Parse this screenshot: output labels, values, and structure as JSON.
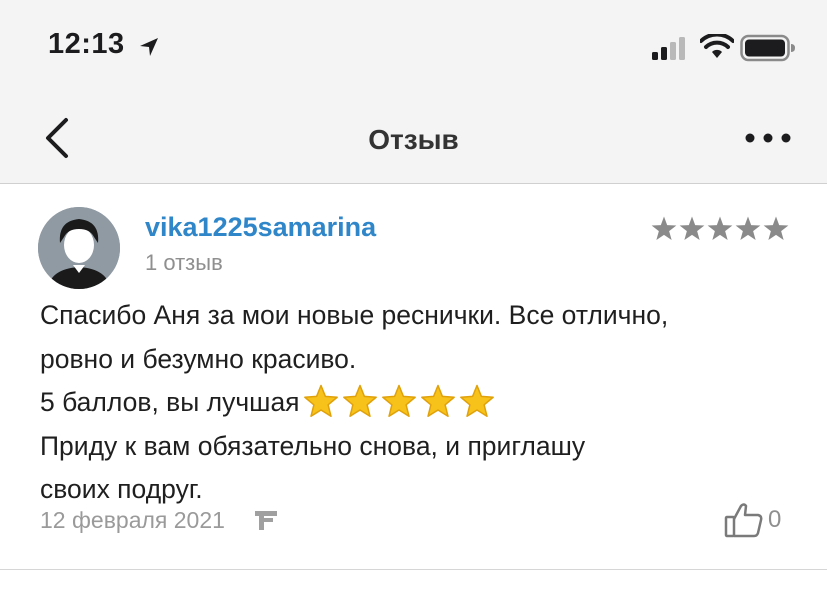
{
  "status_bar": {
    "time": "12:13",
    "icons": [
      "location-arrow-icon",
      "cellular-signal-icon",
      "wifi-icon",
      "battery-icon"
    ]
  },
  "nav": {
    "title": "Отзыв",
    "icons": [
      "chevron-left-icon",
      "more-horizontal-icon"
    ]
  },
  "review": {
    "username": "vika1225samarina",
    "reviews_count": "1 отзыв",
    "rating": 5,
    "rating_max": 5,
    "lines": [
      "Спасибо Аня за мои новые реснички. Все отлично,",
      "ровно и безумно красиво.",
      "5 баллов, вы лучшая",
      "Приду к вам обязательно снова, и приглашу",
      "своих подруг."
    ],
    "emoji_star_count": 5,
    "date": "12 февраля 2021",
    "likes": "0"
  },
  "colors": {
    "username": "#2f86c9",
    "secondary_text": "#8f8f8f",
    "stars": "#8a8a8a",
    "emoji_star": "#f7c21a"
  }
}
